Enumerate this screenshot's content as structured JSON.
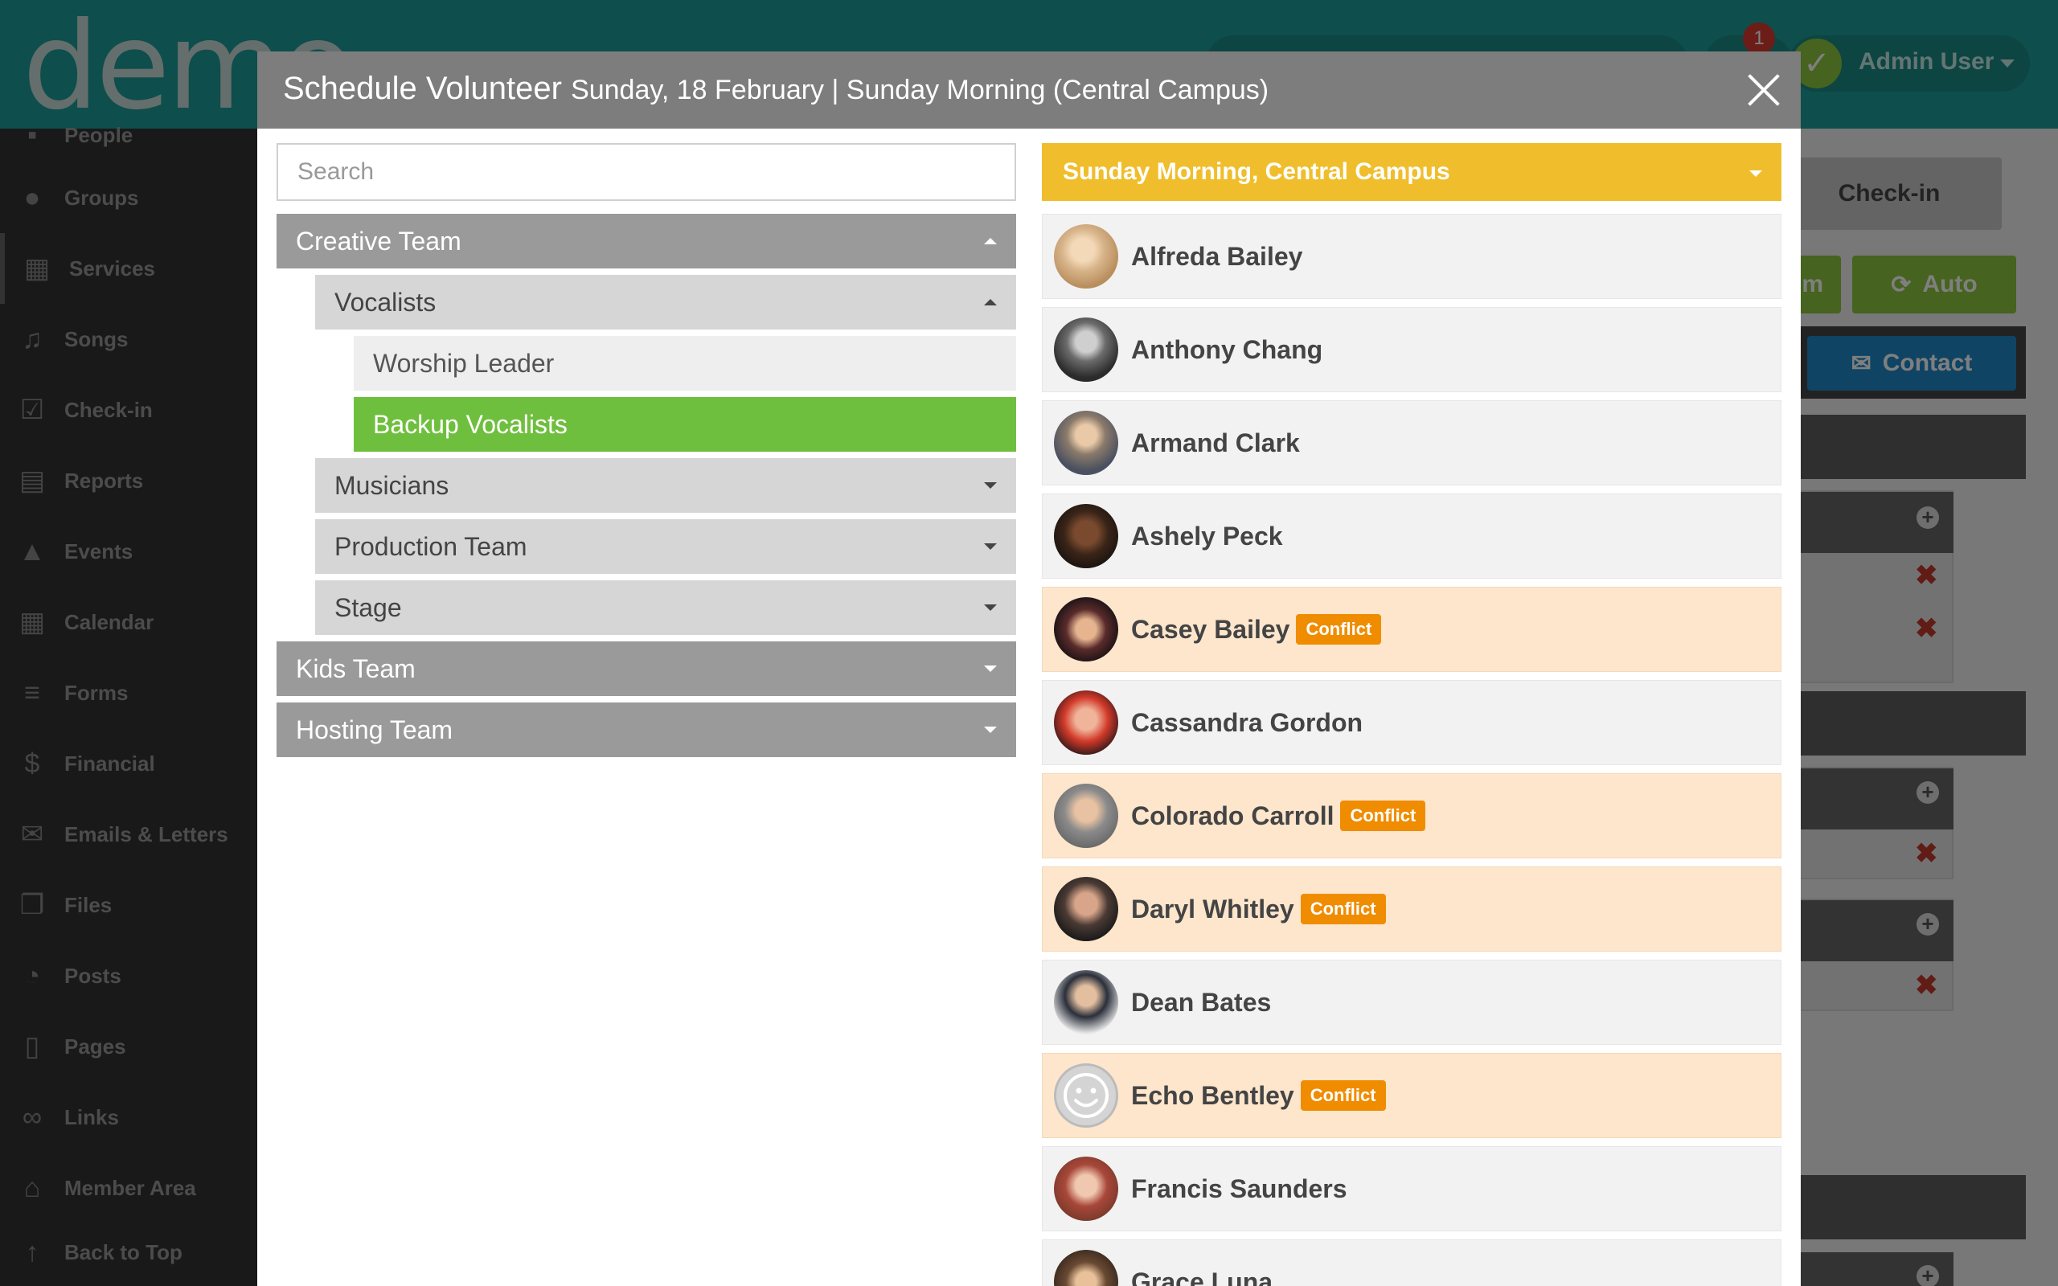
{
  "app": {
    "logo_text": "demo",
    "notification_count": "1",
    "user_name": "Admin User"
  },
  "sidebar": {
    "items": [
      {
        "label": "People",
        "icon": "people-icon"
      },
      {
        "label": "Groups",
        "icon": "groups-icon"
      },
      {
        "label": "Services",
        "icon": "calendar-icon"
      },
      {
        "label": "Songs",
        "icon": "music-note-icon"
      },
      {
        "label": "Check-in",
        "icon": "checkbox-icon"
      },
      {
        "label": "Reports",
        "icon": "document-icon"
      },
      {
        "label": "Events",
        "icon": "cake-icon"
      },
      {
        "label": "Calendar",
        "icon": "calendar-icon"
      },
      {
        "label": "Forms",
        "icon": "list-icon"
      },
      {
        "label": "Financial",
        "icon": "dollar-icon"
      },
      {
        "label": "Emails & Letters",
        "icon": "envelope-icon"
      },
      {
        "label": "Files",
        "icon": "files-icon"
      },
      {
        "label": "Posts",
        "icon": "rss-icon"
      },
      {
        "label": "Pages",
        "icon": "page-icon"
      },
      {
        "label": "Links",
        "icon": "link-icon"
      },
      {
        "label": "Member Area",
        "icon": "home-icon"
      },
      {
        "label": "Back to Top",
        "icon": "arrow-up-icon"
      }
    ]
  },
  "background": {
    "checkin_tab": "Check-in",
    "partial_button": "m",
    "auto_button": "Auto",
    "contact_button": "Contact"
  },
  "modal": {
    "title": "Schedule Volunteer",
    "subtitle": "Sunday, 18 February | Sunday Morning (Central Campus)",
    "search_placeholder": "Search",
    "tree": [
      {
        "label": "Creative Team",
        "level": 0,
        "expanded": true
      },
      {
        "label": "Vocalists",
        "level": 1,
        "expanded": true
      },
      {
        "label": "Worship Leader",
        "level": 2
      },
      {
        "label": "Backup Vocalists",
        "level": 2,
        "selected": true
      },
      {
        "label": "Musicians",
        "level": 1
      },
      {
        "label": "Production Team",
        "level": 1
      },
      {
        "label": "Stage",
        "level": 1
      },
      {
        "label": "Kids Team",
        "level": 0
      },
      {
        "label": "Hosting Team",
        "level": 0
      }
    ],
    "campus_select": "Sunday Morning, Central Campus",
    "conflict_label": "Conflict",
    "volunteers": [
      {
        "name": "Alfreda Bailey",
        "conflict": false
      },
      {
        "name": "Anthony Chang",
        "conflict": false
      },
      {
        "name": "Armand Clark",
        "conflict": false
      },
      {
        "name": "Ashely Peck",
        "conflict": false
      },
      {
        "name": "Casey Bailey",
        "conflict": true
      },
      {
        "name": "Cassandra Gordon",
        "conflict": false
      },
      {
        "name": "Colorado Carroll",
        "conflict": true
      },
      {
        "name": "Daryl Whitley",
        "conflict": true
      },
      {
        "name": "Dean Bates",
        "conflict": false
      },
      {
        "name": "Echo Bentley",
        "conflict": true
      },
      {
        "name": "Francis Saunders",
        "conflict": false
      },
      {
        "name": "Grace Luna",
        "conflict": false
      }
    ]
  },
  "colors": {
    "brand_teal": "#1c9d98",
    "selected_green": "#6fbf3e",
    "campus_yellow": "#f0be2c",
    "conflict_orange": "#f08c00",
    "conflict_row": "#fde6cc"
  }
}
